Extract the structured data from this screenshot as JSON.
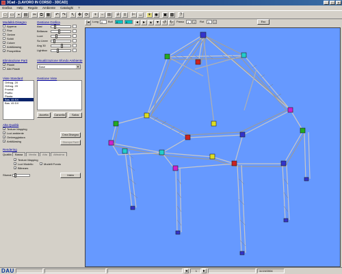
{
  "window": {
    "title": "3Cad - [LAVORO IN CORSO - 3DCAD]",
    "min": "_",
    "max": "□",
    "close": "×"
  },
  "menu": [
    "Grafica",
    "Help",
    "Regole",
    "Ambiente",
    "Cataloghi",
    "?"
  ],
  "toolbar": {
    "lung_label": "Lung",
    "lung_value": "0",
    "bull_label": "Bull",
    "field2_value": "0",
    "field3_value": "0",
    "passo_label": "Passo",
    "passo_value": "1",
    "rot_label": "Rot",
    "rot_value": "3",
    "esc_label": "Esc"
  },
  "left_panel": {
    "modalita": {
      "title": "Modalità Disegno",
      "items": [
        {
          "label": "Appena",
          "checked": false
        },
        {
          "label": "Fine",
          "checked": false
        },
        {
          "label": "Ombre",
          "checked": false
        },
        {
          "label": "Solidi",
          "checked": false
        },
        {
          "label": "Colore",
          "checked": true
        },
        {
          "label": "AntiAliasing",
          "checked": false
        },
        {
          "label": "Prospettiva",
          "checked": true
        }
      ]
    },
    "gestione_grafica": {
      "title": "Gestione Grafica",
      "sliders": [
        {
          "label": "Assi"
        },
        {
          "label": "Brillanza"
        },
        {
          "label": "Luce"
        },
        {
          "label": "Su Linee"
        },
        {
          "label": "Ang 30"
        },
        {
          "label": "Lightbox"
        }
      ]
    },
    "eliminazione": {
      "title": "Eliminazione Parti",
      "items": [
        {
          "label": "Piastri",
          "checked": true
        },
        {
          "label": "Altri Piastri",
          "checked": false
        }
      ]
    },
    "visualizzazione": {
      "title": "Visualizzazione Sfondo Ambiente",
      "combo_value": "Base"
    },
    "viste": {
      "title": "Viste Standard",
      "items": [
        "Orthog. 2X",
        "Orthog. 2X",
        "Frontal",
        "Profilo",
        "Planta",
        "Bas. 45 SX",
        "Bas. 45 DX"
      ],
      "selected": 5
    },
    "gestione_viste": {
      "title": "Gestione Viste",
      "accetta": "Accetta",
      "cancella": "Cancella",
      "salva": "Salva"
    },
    "alta_qualita": {
      "title": "Alta Qualità",
      "items": [
        {
          "label": "Texture Mapping",
          "checked": true
        },
        {
          "label": "Luci ambiente",
          "checked": true
        },
        {
          "label": "Ombreggiatura",
          "checked": true
        },
        {
          "label": "AntiAliasing",
          "checked": true
        }
      ],
      "crea_button": "Crea Disegno",
      "stampa_button": "Stampa Parti"
    },
    "rendering": {
      "title": "Rendering",
      "qualita_label": "Qualità",
      "tabs": [
        "Bassa",
        "Media",
        "Alta",
        "Altissima"
      ],
      "items": [
        {
          "label": "Texture Mapping",
          "checked": true
        },
        {
          "label": "Luci Modello",
          "checked": true
        },
        {
          "label": "Bilinears",
          "checked": true
        }
      ],
      "modelli_label": "Modelli Fondo",
      "modelli_checked": true,
      "sfumat_label": "Sfumat",
      "inizia_button": "Inizia"
    }
  },
  "status": {
    "logo": "DAU",
    "page": "1",
    "date": "11/19/2004"
  },
  "colors": {
    "viewport_bg": "#6699ff",
    "titlebar": "#0a246a",
    "frame_accent": "#00c0c0"
  }
}
